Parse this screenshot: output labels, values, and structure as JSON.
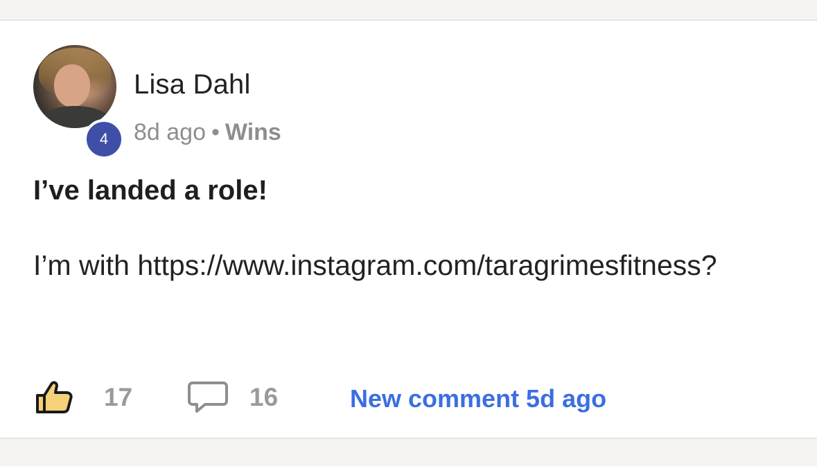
{
  "post": {
    "author": "Lisa Dahl",
    "level": "4",
    "time": "8d ago",
    "separator": "•",
    "category": "Wins",
    "title": "I’ve landed a role!",
    "body": "I’m with https://www.instagram.com/taragrimesfitness?",
    "likes": "17",
    "comments": "16",
    "new_comment": "New comment 5d ago"
  },
  "icons": {
    "like": "thumbs-up-icon",
    "comment": "comment-bubble-icon"
  },
  "colors": {
    "badge": "#3f4fa8",
    "link": "#3b6fe0",
    "like_fill": "#f5d27a",
    "muted": "#8e8e8e"
  }
}
